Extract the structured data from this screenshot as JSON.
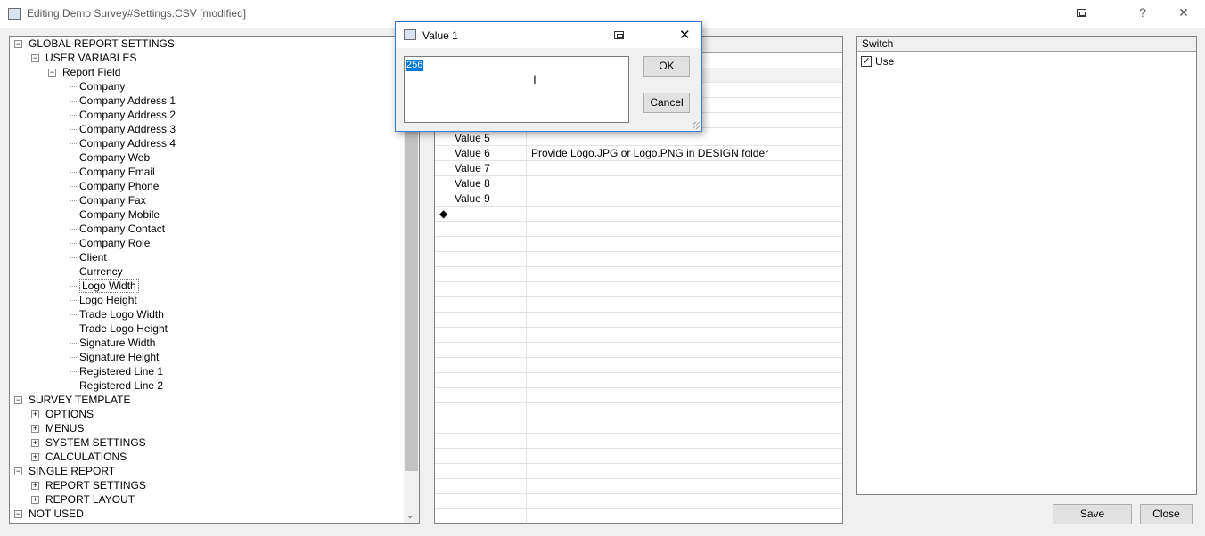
{
  "window": {
    "title": "Editing Demo Survey#Settings.CSV [modified]",
    "help": "?",
    "close": "✕"
  },
  "tree": {
    "items": [
      {
        "label": "GLOBAL REPORT SETTINGS",
        "level": 0,
        "expander": "minus"
      },
      {
        "label": "USER VARIABLES",
        "level": 1,
        "expander": "minus"
      },
      {
        "label": "Report Field",
        "level": 2,
        "expander": "minus"
      },
      {
        "label": "Company",
        "level": 3
      },
      {
        "label": "Company Address 1",
        "level": 3
      },
      {
        "label": "Company Address 2",
        "level": 3
      },
      {
        "label": "Company Address 3",
        "level": 3
      },
      {
        "label": "Company Address 4",
        "level": 3
      },
      {
        "label": "Company Web",
        "level": 3
      },
      {
        "label": "Company Email",
        "level": 3
      },
      {
        "label": "Company Phone",
        "level": 3
      },
      {
        "label": "Company Fax",
        "level": 3
      },
      {
        "label": "Company Mobile",
        "level": 3
      },
      {
        "label": "Company Contact",
        "level": 3
      },
      {
        "label": "Company Role",
        "level": 3
      },
      {
        "label": "Client",
        "level": 3
      },
      {
        "label": "Currency",
        "level": 3
      },
      {
        "label": "Logo Width",
        "level": 3,
        "selected": true
      },
      {
        "label": "Logo Height",
        "level": 3
      },
      {
        "label": "Trade Logo Width",
        "level": 3
      },
      {
        "label": "Trade Logo Height",
        "level": 3
      },
      {
        "label": "Signature Width",
        "level": 3
      },
      {
        "label": "Signature Height",
        "level": 3
      },
      {
        "label": "Registered Line 1",
        "level": 3
      },
      {
        "label": "Registered Line 2",
        "level": 3
      },
      {
        "label": "SURVEY TEMPLATE",
        "level": 0,
        "expander": "minus"
      },
      {
        "label": "OPTIONS",
        "level": 1,
        "expander": "plus"
      },
      {
        "label": "MENUS",
        "level": 1,
        "expander": "plus"
      },
      {
        "label": "SYSTEM SETTINGS",
        "level": 1,
        "expander": "plus"
      },
      {
        "label": "CALCULATIONS",
        "level": 1,
        "expander": "plus"
      },
      {
        "label": "SINGLE REPORT",
        "level": 0,
        "expander": "minus"
      },
      {
        "label": "REPORT SETTINGS",
        "level": 1,
        "expander": "plus"
      },
      {
        "label": "REPORT LAYOUT",
        "level": 1,
        "expander": "plus"
      },
      {
        "label": "NOT USED",
        "level": 0,
        "expander": "minus"
      }
    ],
    "scroll_arrow": "⌄"
  },
  "grid": {
    "rows": [
      {
        "name": "Value 5",
        "value": ""
      },
      {
        "name": "Value 6",
        "value": "Provide Logo.JPG or Logo.PNG in DESIGN folder"
      },
      {
        "name": "Value 7",
        "value": ""
      },
      {
        "name": "Value 8",
        "value": ""
      },
      {
        "name": "Value 9",
        "value": ""
      }
    ],
    "new_row_marker": "◆"
  },
  "switch": {
    "header": "Switch",
    "use_label": "Use",
    "use_checked": true
  },
  "buttons": {
    "save": "Save",
    "close": "Close"
  },
  "dialog": {
    "title": "Value 1",
    "value": "256",
    "ok": "OK",
    "cancel": "Cancel",
    "close": "✕"
  }
}
